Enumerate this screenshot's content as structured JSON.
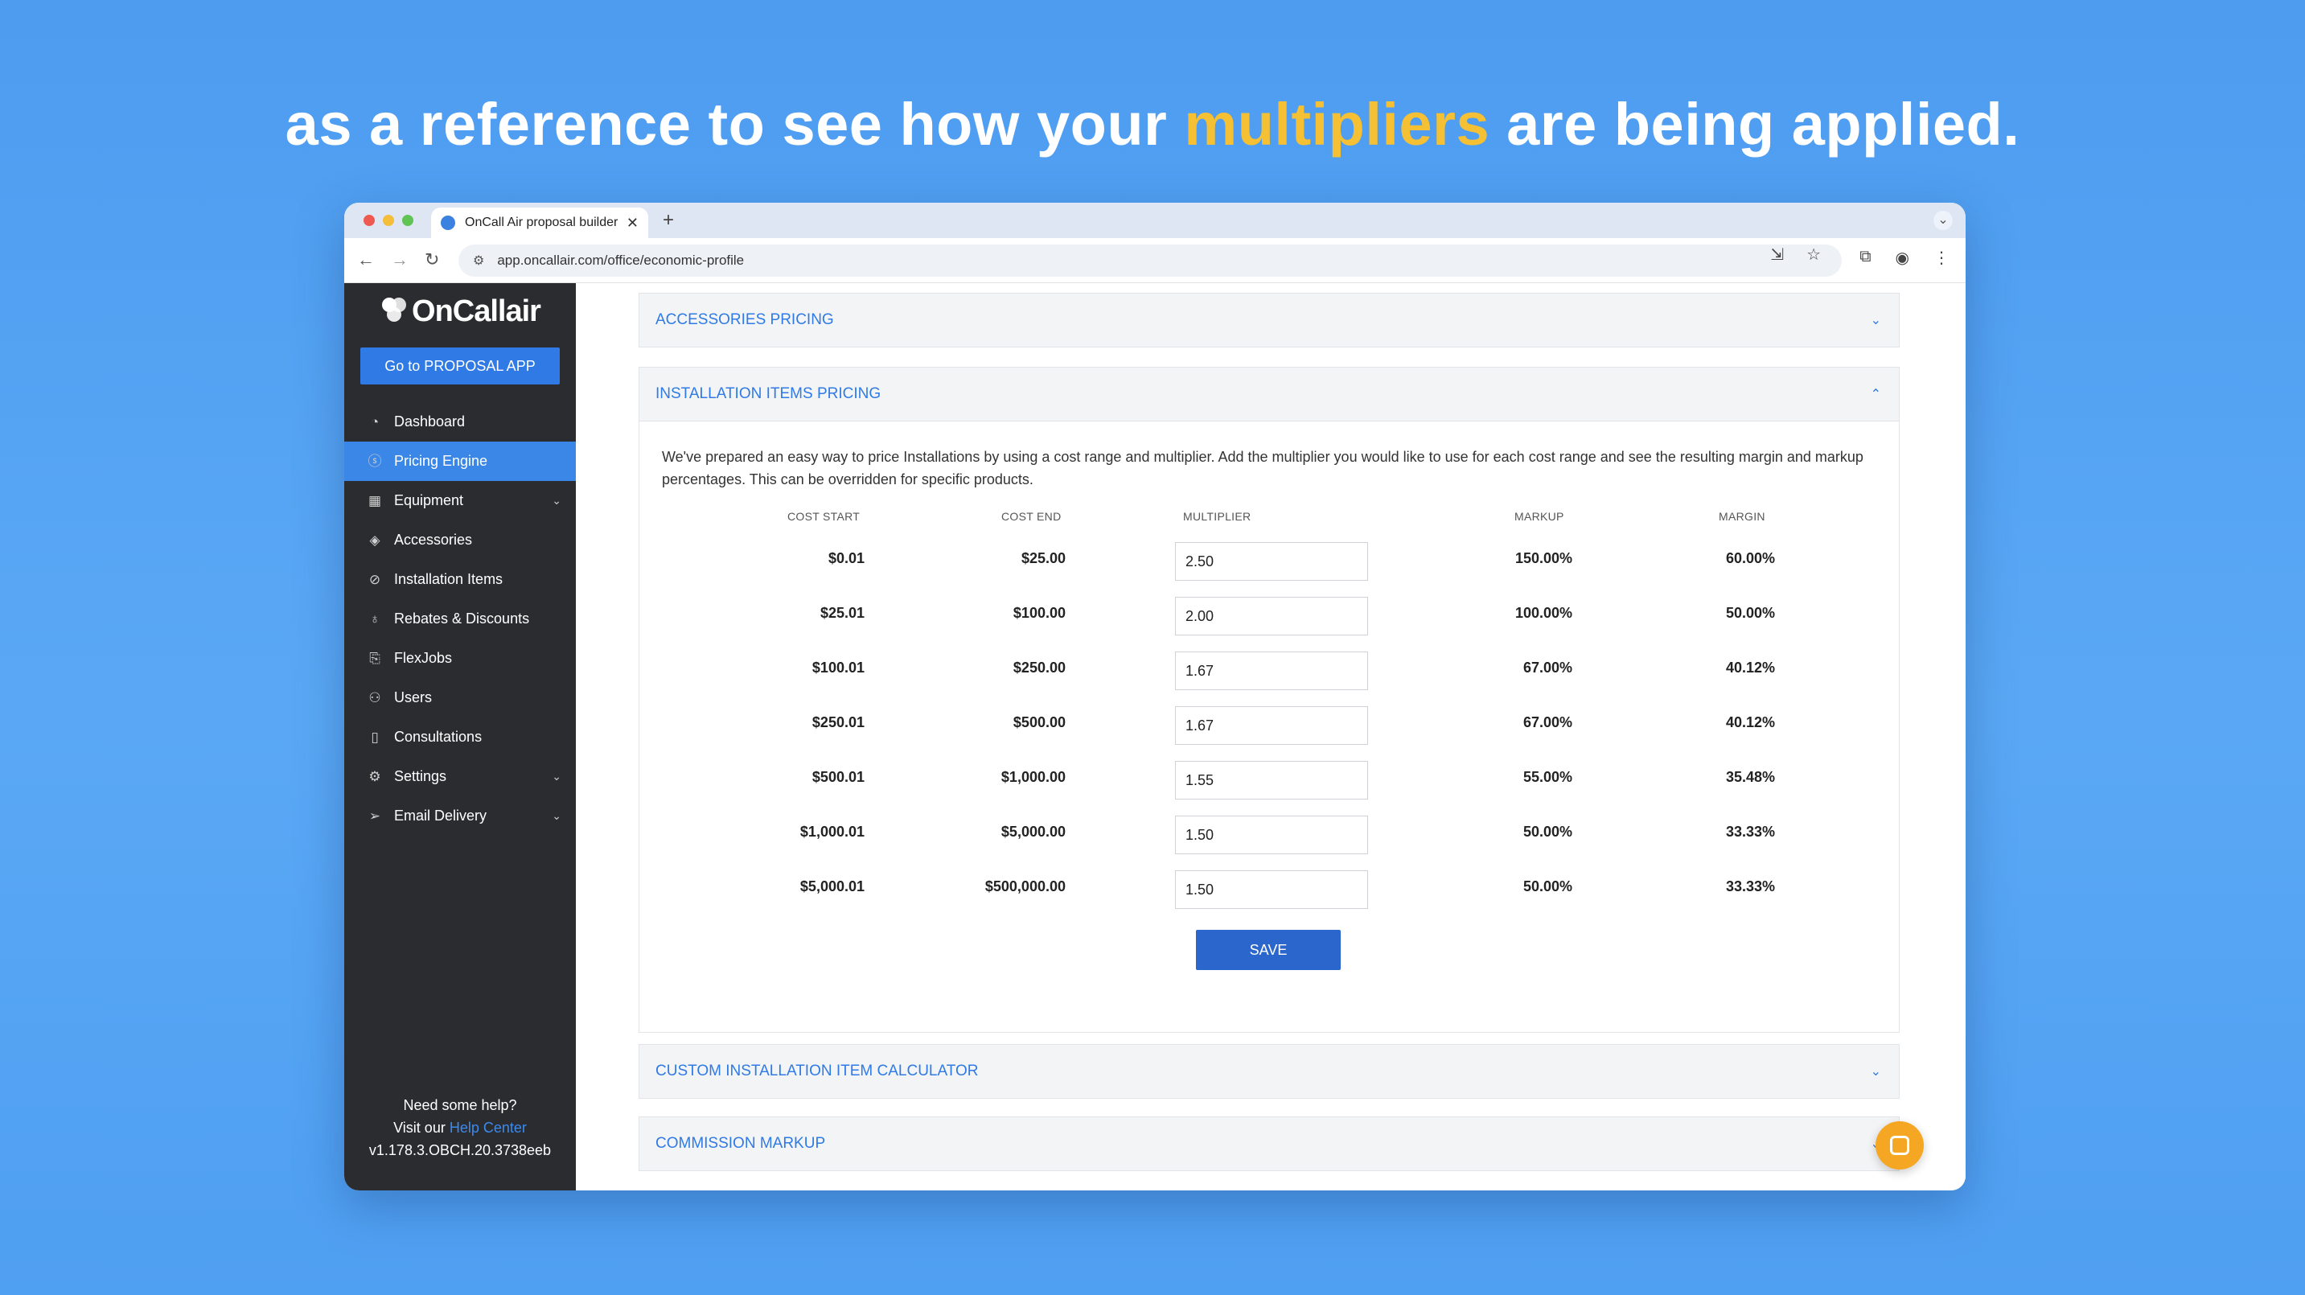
{
  "headline": {
    "before": "as a reference to see how your ",
    "highlight": "multipliers",
    "after": " are being applied."
  },
  "colors": {
    "background": "#4d9cf0",
    "highlight": "#f5c033",
    "sidebar": "#2b2c30",
    "accent": "#3a87e8",
    "save_button": "#2a66cc"
  },
  "browser": {
    "tab_title": "OnCall Air proposal builder",
    "url": "app.oncallair.com/office/economic-profile"
  },
  "sidebar": {
    "logo": "OnCallair",
    "proposal_button": "Go to PROPOSAL APP",
    "items": [
      {
        "label": "Dashboard",
        "icon": "dashboard-icon",
        "active": false,
        "expandable": false
      },
      {
        "label": "Pricing Engine",
        "icon": "dollar-icon",
        "active": true,
        "expandable": false
      },
      {
        "label": "Equipment",
        "icon": "grid-icon",
        "active": false,
        "expandable": true
      },
      {
        "label": "Accessories",
        "icon": "layers-icon",
        "active": false,
        "expandable": false
      },
      {
        "label": "Installation Items",
        "icon": "wrench-icon",
        "active": false,
        "expandable": false
      },
      {
        "label": "Rebates & Discounts",
        "icon": "award-icon",
        "active": false,
        "expandable": false
      },
      {
        "label": "FlexJobs",
        "icon": "flex-icon",
        "active": false,
        "expandable": false
      },
      {
        "label": "Users",
        "icon": "users-icon",
        "active": false,
        "expandable": false
      },
      {
        "label": "Consultations",
        "icon": "document-icon",
        "active": false,
        "expandable": false
      },
      {
        "label": "Settings",
        "icon": "gear-icon",
        "active": false,
        "expandable": true
      },
      {
        "label": "Email Delivery",
        "icon": "send-icon",
        "active": false,
        "expandable": true
      }
    ],
    "help_line1": "Need some help?",
    "help_prefix": "Visit our ",
    "help_link": "Help Center",
    "version": "v1.178.3.OBCH.20.3738eeb"
  },
  "panels": {
    "accessories": "ACCESSORIES PRICING",
    "installation": "INSTALLATION ITEMS PRICING",
    "calculator": "CUSTOM INSTALLATION ITEM CALCULATOR",
    "commission": "COMMISSION MARKUP"
  },
  "installation": {
    "intro": "We've prepared an easy way to price Installations by using a cost range and multiplier. Add the multiplier you would like to use for each cost range and see the resulting margin and markup percentages. This can be overridden for specific products.",
    "headers": {
      "cost_start": "COST START",
      "cost_end": "COST END",
      "multiplier": "MULTIPLIER",
      "markup": "MARKUP",
      "margin": "MARGIN"
    },
    "rows": [
      {
        "cost_start": "$0.01",
        "cost_end": "$25.00",
        "multiplier": "2.50",
        "markup": "150.00%",
        "margin": "60.00%"
      },
      {
        "cost_start": "$25.01",
        "cost_end": "$100.00",
        "multiplier": "2.00",
        "markup": "100.00%",
        "margin": "50.00%"
      },
      {
        "cost_start": "$100.01",
        "cost_end": "$250.00",
        "multiplier": "1.67",
        "markup": "67.00%",
        "margin": "40.12%"
      },
      {
        "cost_start": "$250.01",
        "cost_end": "$500.00",
        "multiplier": "1.67",
        "markup": "67.00%",
        "margin": "40.12%"
      },
      {
        "cost_start": "$500.01",
        "cost_end": "$1,000.00",
        "multiplier": "1.55",
        "markup": "55.00%",
        "margin": "35.48%"
      },
      {
        "cost_start": "$1,000.01",
        "cost_end": "$5,000.00",
        "multiplier": "1.50",
        "markup": "50.00%",
        "margin": "33.33%"
      },
      {
        "cost_start": "$5,000.01",
        "cost_end": "$500,000.00",
        "multiplier": "1.50",
        "markup": "50.00%",
        "margin": "33.33%"
      }
    ],
    "save_label": "SAVE"
  }
}
